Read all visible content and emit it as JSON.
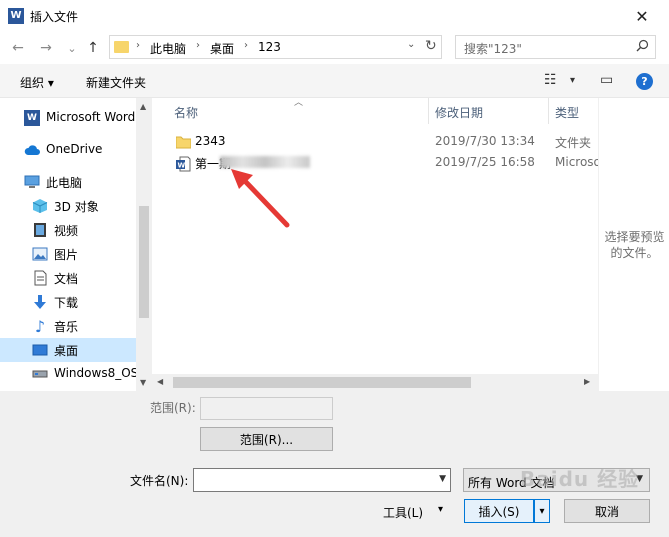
{
  "title_bar": {
    "app_icon": "W",
    "title": "插入文件",
    "close": "✕"
  },
  "nav": {
    "back": "←",
    "forward": "→",
    "recent": "⌄",
    "up": "↑",
    "breadcrumb": [
      "此电脑",
      "桌面",
      "123"
    ],
    "crumb_sep": "›",
    "address_dropdown": "⌄",
    "refresh": "↻",
    "search_placeholder": "搜索\"123\""
  },
  "toolbar": {
    "organize": "组织 ▾",
    "new_folder": "新建文件夹",
    "view_icon": "☷",
    "view_dropdown": "▾",
    "pane_icon": "▭",
    "help": "?"
  },
  "sidebar": {
    "items": [
      {
        "label": "Microsoft Word",
        "icon": "word-icon"
      },
      {
        "label": "OneDrive",
        "icon": "cloud-icon"
      },
      {
        "label": "此电脑",
        "icon": "computer-icon"
      },
      {
        "label": "3D 对象",
        "icon": "cube-icon"
      },
      {
        "label": "视频",
        "icon": "video-icon"
      },
      {
        "label": "图片",
        "icon": "picture-icon"
      },
      {
        "label": "文档",
        "icon": "document-icon"
      },
      {
        "label": "下载",
        "icon": "download-icon"
      },
      {
        "label": "音乐",
        "icon": "music-icon"
      },
      {
        "label": "桌面",
        "icon": "desktop-icon",
        "selected": true
      },
      {
        "label": "Windows8_OS",
        "icon": "drive-icon"
      }
    ]
  },
  "columns": {
    "name": "名称",
    "date": "修改日期",
    "type": "类型"
  },
  "files": [
    {
      "name": "2343",
      "date": "2019/7/30 13:34",
      "type": "文件夹",
      "icon": "folder-icon"
    },
    {
      "name": "第一期",
      "date": "2019/7/25 16:58",
      "type": "Microsoft Word",
      "icon": "word-doc-icon",
      "name_blurred": true
    }
  ],
  "preview": {
    "text_line1": "选择要预览",
    "text_line2": "的文件。"
  },
  "bottom": {
    "range_label": "范围(R):",
    "range_button": "范围(R)...",
    "filename_label": "文件名(N):",
    "filename_value": "",
    "filetype_value": "所有 Word 文档",
    "tools": "工具(L)",
    "tools_dd": "▾",
    "insert": "插入(S)",
    "insert_dd": "▾",
    "cancel": "取消",
    "watermark": "Baidu 经验"
  },
  "colors": {
    "selected_bg": "#cce8ff",
    "folder": "#f7d56b",
    "word_blue": "#2b579a",
    "help_blue": "#1e6fd0",
    "annotation_red": "#e53935"
  }
}
